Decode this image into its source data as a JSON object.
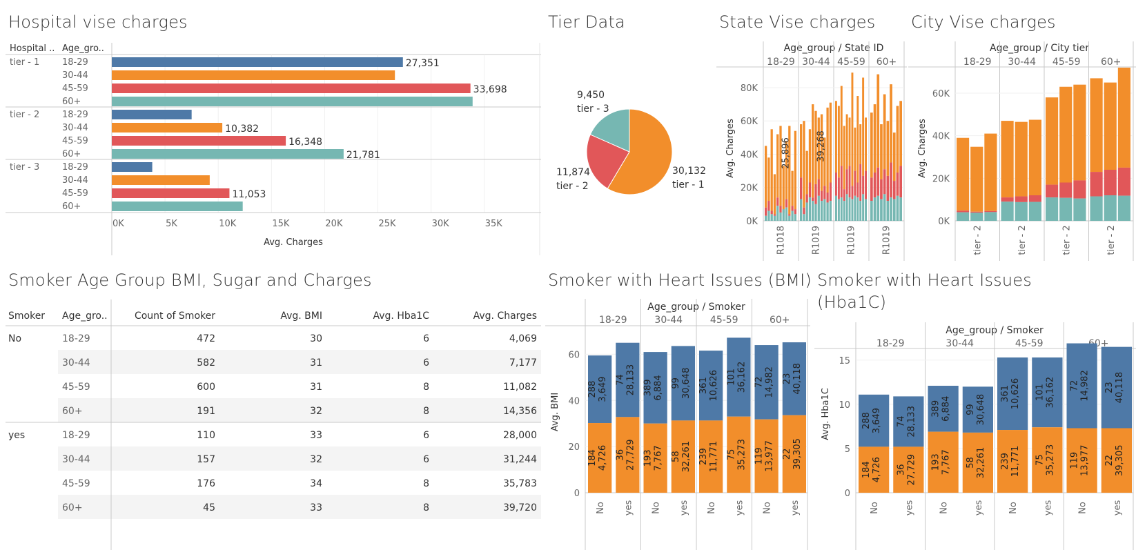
{
  "titles": {
    "hospital": "Hospital vise charges",
    "tier": "Tier Data",
    "state": "State Vise charges",
    "city": "City Vise charges",
    "smoker_table": "Smoker Age Group BMI, Sugar and Charges",
    "heart_bmi": "Smoker with Heart Issues (BMI)",
    "heart_hba1c_line1": "Smoker with Heart Issues",
    "heart_hba1c_line2": "(Hba1C)"
  },
  "colors": {
    "18-29": "#4e79a7",
    "30-44": "#f28e2b",
    "45-59": "#e15759",
    "60+": "#76b7b2"
  },
  "table": {
    "headers": [
      "Smoker",
      "Age_gro..",
      "Count of Smoker",
      "Avg. BMI",
      "Avg. Hba1C",
      "Avg. Charges"
    ],
    "groups": [
      {
        "smoker": "No",
        "rows": [
          [
            "18-29",
            "472",
            "30",
            "6",
            "4,069"
          ],
          [
            "30-44",
            "582",
            "31",
            "6",
            "7,177"
          ],
          [
            "45-59",
            "600",
            "31",
            "8",
            "11,082"
          ],
          [
            "60+",
            "191",
            "32",
            "8",
            "14,356"
          ]
        ]
      },
      {
        "smoker": "yes",
        "rows": [
          [
            "18-29",
            "110",
            "33",
            "6",
            "28,000"
          ],
          [
            "30-44",
            "157",
            "32",
            "6",
            "31,244"
          ],
          [
            "45-59",
            "176",
            "34",
            "8",
            "35,783"
          ],
          [
            "60+",
            "45",
            "33",
            "8",
            "39,720"
          ]
        ]
      }
    ]
  },
  "chart_data": [
    {
      "id": "hospital",
      "type": "bar",
      "orientation": "horizontal",
      "title": "Hospital vise charges",
      "row_headers": [
        "Hospital ..",
        "Age_gro.."
      ],
      "xlabel": "Avg. Charges",
      "xlim": [
        0,
        38000
      ],
      "xticks": [
        "0K",
        "5K",
        "10K",
        "15K",
        "20K",
        "25K",
        "30K",
        "35K"
      ],
      "groups": [
        {
          "name": "tier - 1",
          "bars": [
            {
              "age": "18-29",
              "value": 27351,
              "label": "27,351"
            },
            {
              "age": "30-44",
              "value": 26600,
              "label": ""
            },
            {
              "age": "45-59",
              "value": 33698,
              "label": "33,698"
            },
            {
              "age": "60+",
              "value": 33900,
              "label": ""
            }
          ]
        },
        {
          "name": "tier - 2",
          "bars": [
            {
              "age": "18-29",
              "value": 7500,
              "label": ""
            },
            {
              "age": "30-44",
              "value": 10382,
              "label": "10,382"
            },
            {
              "age": "45-59",
              "value": 16348,
              "label": "16,348"
            },
            {
              "age": "60+",
              "value": 21781,
              "label": "21,781"
            }
          ]
        },
        {
          "name": "tier - 3",
          "bars": [
            {
              "age": "18-29",
              "value": 3800,
              "label": ""
            },
            {
              "age": "30-44",
              "value": 9200,
              "label": ""
            },
            {
              "age": "45-59",
              "value": 11053,
              "label": "11,053"
            },
            {
              "age": "60+",
              "value": 12300,
              "label": ""
            }
          ]
        }
      ]
    },
    {
      "id": "tier",
      "type": "pie",
      "title": "Tier Data",
      "slices": [
        {
          "name": "tier - 1",
          "value": 30132,
          "label": "30,132",
          "color": "#f28e2b"
        },
        {
          "name": "tier - 2",
          "value": 11874,
          "label": "11,874",
          "color": "#e15759"
        },
        {
          "name": "tier - 3",
          "value": 9450,
          "label": "9,450",
          "color": "#76b7b2"
        }
      ]
    },
    {
      "id": "state",
      "type": "bar",
      "stacked": true,
      "title": "State Vise charges",
      "header": "Age_group  /  State ID",
      "groups": [
        "18-29",
        "30-44",
        "45-59",
        "60+"
      ],
      "xlabels": [
        "R1018",
        "R1019",
        "R1019",
        "R1019"
      ],
      "ylabel": "Avg. Charges",
      "ylim": [
        0,
        92000
      ],
      "yticks": [
        0,
        20000,
        40000,
        60000,
        80000
      ],
      "ytick_labels": [
        "0K",
        "20K",
        "40K",
        "60K",
        "80K"
      ],
      "annotations": [
        {
          "group": "18-29",
          "text": "25,896"
        },
        {
          "group": "30-44",
          "text": "39,268"
        }
      ],
      "totals": [
        [
          45000,
          38000,
          55000,
          28000,
          52000,
          57000,
          33000,
          48000,
          57000,
          30000,
          54000
        ],
        [
          58000,
          60000,
          42000,
          55000,
          70000,
          66000,
          62000,
          64000,
          50000,
          68000,
          71000
        ],
        [
          72000,
          69000,
          81000,
          57000,
          64000,
          62000,
          89000,
          56000,
          75000,
          58000,
          86000,
          62000
        ],
        [
          65000,
          70000,
          88000,
          58000,
          76000,
          60000,
          82000,
          53000,
          69000,
          72000
        ]
      ],
      "orange_split": [
        [
          8000,
          12000,
          6000,
          4000,
          14000,
          9000,
          5000,
          13000,
          4000,
          9000,
          7000
        ],
        [
          26000,
          8000,
          16000,
          23000,
          14000,
          22000,
          25000,
          18000,
          21000,
          17000,
          23000
        ],
        [
          29000,
          26000,
          33000,
          19000,
          31000,
          33000,
          21000,
          30000,
          23000,
          34000,
          27000,
          30000
        ],
        [
          26000,
          29000,
          32000,
          25000,
          31000,
          27000,
          35000,
          24000,
          29000,
          33000
        ]
      ],
      "teal_split": [
        [
          3000,
          6000,
          4000,
          3000,
          9000,
          5000,
          7000,
          8000,
          3000,
          6000,
          4000
        ],
        [
          13000,
          4000,
          11000,
          14000,
          12000,
          10000,
          15000,
          12000,
          13000,
          11000,
          12000
        ],
        [
          15000,
          13000,
          14000,
          12000,
          16000,
          14000,
          13000,
          15000,
          14000,
          12000,
          16000,
          13000
        ],
        [
          12000,
          14000,
          15000,
          13000,
          16000,
          12000,
          14000,
          13000,
          15000,
          14000
        ]
      ]
    },
    {
      "id": "city",
      "type": "bar",
      "stacked": true,
      "title": "City Vise charges",
      "header": "Age_group  /  City tier",
      "groups": [
        "18-29",
        "30-44",
        "45-59",
        "60+"
      ],
      "xlabels": [
        "tier - 2",
        "tier - 2",
        "tier - 2",
        "tier - 2"
      ],
      "ylabel": "Avg. Charges",
      "ylim": [
        0,
        72000
      ],
      "yticks": [
        0,
        20000,
        40000,
        60000
      ],
      "ytick_labels": [
        "0K",
        "20K",
        "40K",
        "60K"
      ],
      "bars": [
        [
          [
            4000,
            4800,
            39000
          ],
          [
            3800,
            4300,
            34800
          ],
          [
            4100,
            4600,
            41000
          ]
        ],
        [
          [
            9000,
            11000,
            47000
          ],
          [
            8800,
            11500,
            46500
          ],
          [
            8900,
            12000,
            47500
          ]
        ],
        [
          [
            11000,
            17000,
            58000
          ],
          [
            10800,
            18000,
            63000
          ],
          [
            10500,
            19000,
            64000
          ]
        ],
        [
          [
            11500,
            23000,
            67000
          ],
          [
            12000,
            24000,
            65000
          ],
          [
            11800,
            25000,
            72000
          ]
        ]
      ]
    },
    {
      "id": "heart_bmi",
      "type": "bar",
      "stacked": true,
      "title": "Smoker with Heart Issues (BMI)",
      "header": "Age_group  /  Smoker",
      "groups": [
        "18-29",
        "30-44",
        "45-59",
        "60+"
      ],
      "categories": [
        "No",
        "yes"
      ],
      "ylabel": "Avg. BMI",
      "ylim": [
        0,
        70
      ],
      "yticks": [
        0,
        20,
        40,
        60
      ],
      "bars": [
        [
          {
            "bottom": 30.2,
            "top": 29.3,
            "b1": "184",
            "b2": "4,726",
            "t1": "288",
            "t2": "3,649"
          },
          {
            "bottom": 32.8,
            "top": 32.2,
            "b1": "36",
            "b2": "27,729",
            "t1": "74",
            "t2": "28,133"
          }
        ],
        [
          {
            "bottom": 30.0,
            "top": 31.0,
            "b1": "193",
            "b2": "7,767",
            "t1": "389",
            "t2": "6,884"
          },
          {
            "bottom": 31.3,
            "top": 32.3,
            "b1": "58",
            "b2": "32,261",
            "t1": "99",
            "t2": "30,648"
          }
        ],
        [
          {
            "bottom": 31.3,
            "top": 30.3,
            "b1": "239",
            "b2": "11,771",
            "t1": "361",
            "t2": "10,626"
          },
          {
            "bottom": 33.0,
            "top": 34.2,
            "b1": "75",
            "b2": "35,273",
            "t1": "101",
            "t2": "36,162"
          }
        ],
        [
          {
            "bottom": 31.8,
            "top": 32.2,
            "b1": "119",
            "b2": "13,977",
            "t1": "72",
            "t2": "14,982"
          },
          {
            "bottom": 33.6,
            "top": 31.6,
            "b1": "22",
            "b2": "39,305",
            "t1": "23",
            "t2": "40,118"
          }
        ]
      ]
    },
    {
      "id": "heart_hba1c",
      "type": "bar",
      "stacked": true,
      "title": "Smoker with Heart Issues (Hba1C)",
      "header": "Age_group  /  Smoker",
      "groups": [
        "18-29",
        "30-44",
        "45-59",
        "60+"
      ],
      "categories": [
        "No",
        "yes"
      ],
      "ylabel": "Avg. Hba1C",
      "ylim": [
        0,
        17.8
      ],
      "yticks": [
        0,
        5,
        10,
        15
      ],
      "bars": [
        [
          {
            "bottom": 5.2,
            "top": 5.9,
            "b1": "184",
            "b2": "4,726",
            "t1": "288",
            "t2": "3,649"
          },
          {
            "bottom": 5.2,
            "top": 5.7,
            "b1": "36",
            "b2": "27,729",
            "t1": "74",
            "t2": "28,133"
          }
        ],
        [
          {
            "bottom": 6.9,
            "top": 5.2,
            "b1": "193",
            "b2": "7,767",
            "t1": "389",
            "t2": "6,884"
          },
          {
            "bottom": 6.8,
            "top": 5.2,
            "b1": "58",
            "b2": "32,261",
            "t1": "99",
            "t2": "30,648"
          }
        ],
        [
          {
            "bottom": 7.1,
            "top": 8.2,
            "b1": "239",
            "b2": "11,771",
            "t1": "361",
            "t2": "10,626"
          },
          {
            "bottom": 7.4,
            "top": 7.9,
            "b1": "75",
            "b2": "35,273",
            "t1": "101",
            "t2": "36,162"
          }
        ],
        [
          {
            "bottom": 7.3,
            "top": 9.6,
            "b1": "119",
            "b2": "13,977",
            "t1": "72",
            "t2": "14,982"
          },
          {
            "bottom": 7.3,
            "top": 9.2,
            "b1": "22",
            "b2": "39,305",
            "t1": "23",
            "t2": "40,118"
          }
        ]
      ]
    }
  ]
}
